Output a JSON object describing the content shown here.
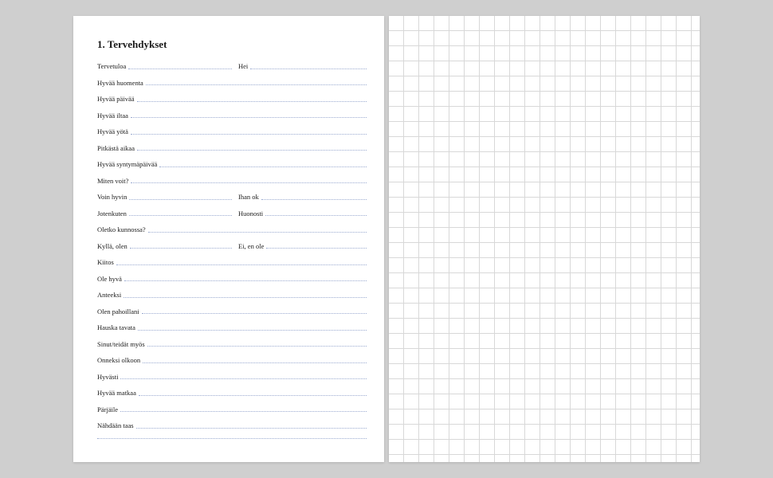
{
  "page_title": "1. Tervehdykset",
  "rows": [
    {
      "type": "pair",
      "left": "Tervetuloa",
      "right": "Hei"
    },
    {
      "type": "single",
      "label": "Hyvää huomenta"
    },
    {
      "type": "single",
      "label": "Hyvää päivää"
    },
    {
      "type": "single",
      "label": "Hyvää iltaa"
    },
    {
      "type": "single",
      "label": "Hyvää yötä"
    },
    {
      "type": "single",
      "label": "Pitkästä aikaa"
    },
    {
      "type": "single",
      "label": "Hyvää syntymäpäivää"
    },
    {
      "type": "single",
      "label": "Miten voit?"
    },
    {
      "type": "pair",
      "left": "Voin hyvin",
      "right": "Ihan ok"
    },
    {
      "type": "pair",
      "left": "Jotenkuten",
      "right": "Huonosti"
    },
    {
      "type": "single",
      "label": "Oletko kunnossa?"
    },
    {
      "type": "pair",
      "left": "Kyllä, olen",
      "right": "Ei, en ole"
    },
    {
      "type": "single",
      "label": "Kiitos"
    },
    {
      "type": "single",
      "label": "Ole hyvä"
    },
    {
      "type": "single",
      "label": "Anteeksi"
    },
    {
      "type": "single",
      "label": "Olen pahoillani"
    },
    {
      "type": "single",
      "label": "Hauska tavata"
    },
    {
      "type": "single",
      "label": "Sinut/teidät myös"
    },
    {
      "type": "single",
      "label": "Onneksi olkoon"
    },
    {
      "type": "single",
      "label": "Hyvästi"
    },
    {
      "type": "single",
      "label": "Hyvää matkaa"
    },
    {
      "type": "single",
      "label": "Pärjäile"
    },
    {
      "type": "single",
      "label": "Nähdään taas"
    },
    {
      "type": "blank"
    }
  ]
}
